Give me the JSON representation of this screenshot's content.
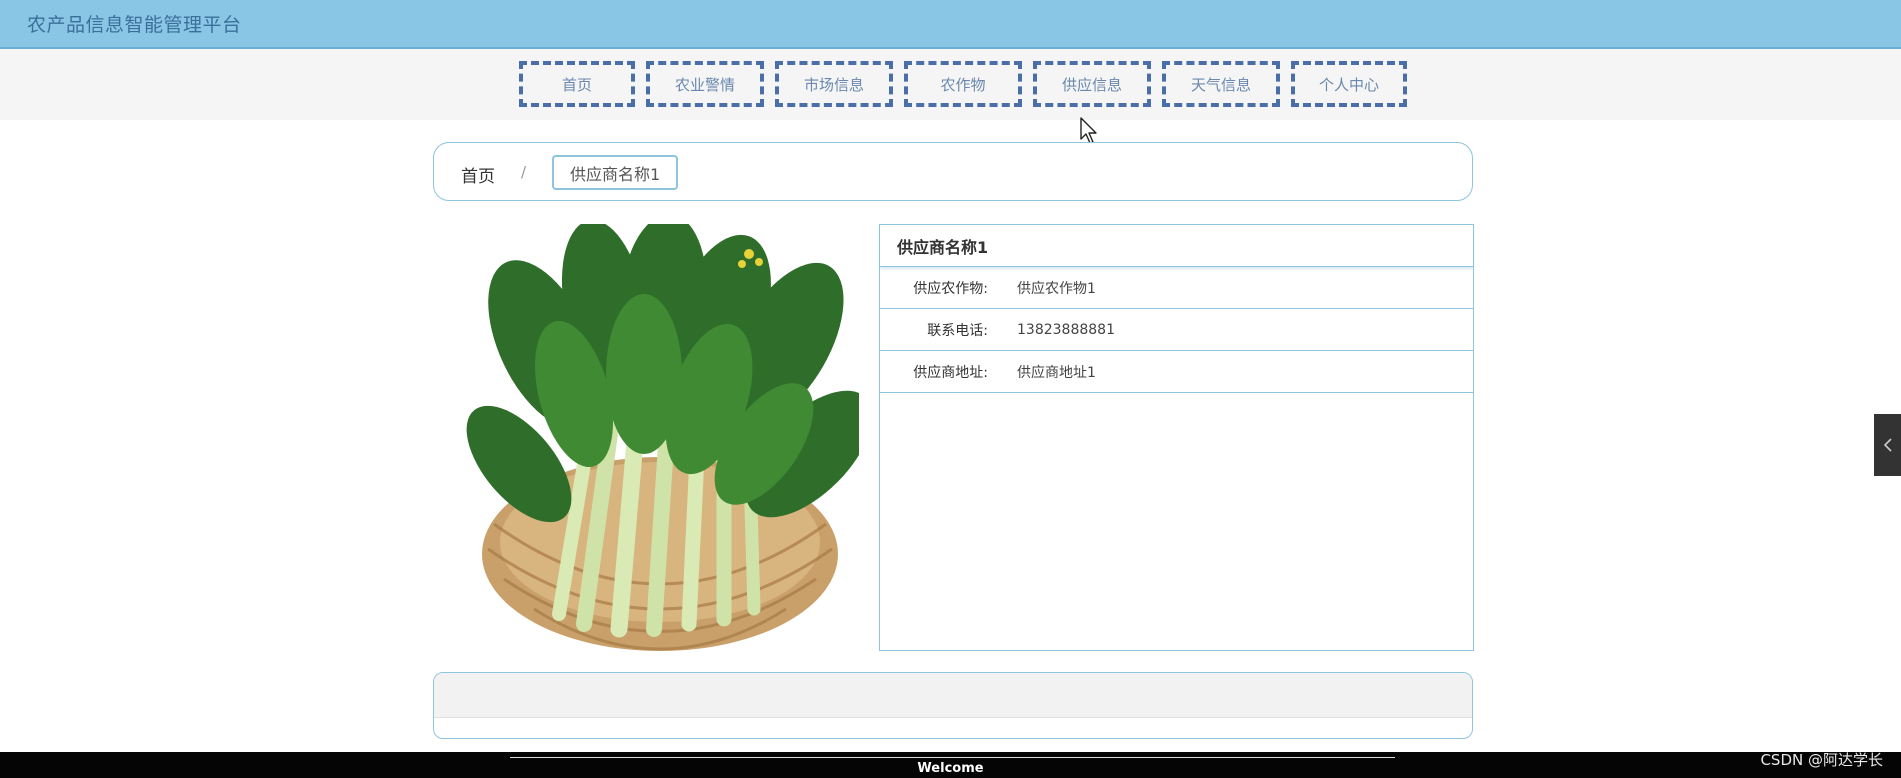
{
  "header": {
    "title": "农产品信息智能管理平台"
  },
  "nav": {
    "items": [
      {
        "label": "首页"
      },
      {
        "label": "农业警情"
      },
      {
        "label": "市场信息"
      },
      {
        "label": "农作物"
      },
      {
        "label": "供应信息"
      },
      {
        "label": "天气信息"
      },
      {
        "label": "个人中心"
      }
    ]
  },
  "breadcrumb": {
    "home": "首页",
    "separator": "/",
    "current": "供应商名称1"
  },
  "detail": {
    "title": "供应商名称1",
    "rows": [
      {
        "label": "供应农作物:",
        "value": "供应农作物1"
      },
      {
        "label": "联系电话:",
        "value": "13823888881"
      },
      {
        "label": "供应商地址:",
        "value": "供应商地址1"
      }
    ]
  },
  "footer": {
    "text": "Welcome"
  },
  "watermark": "CSDN @阿达学长",
  "colors": {
    "topbar": "#89c6e6",
    "nav_border": "#4a6ea8",
    "panel_border": "#8ec4dc"
  }
}
